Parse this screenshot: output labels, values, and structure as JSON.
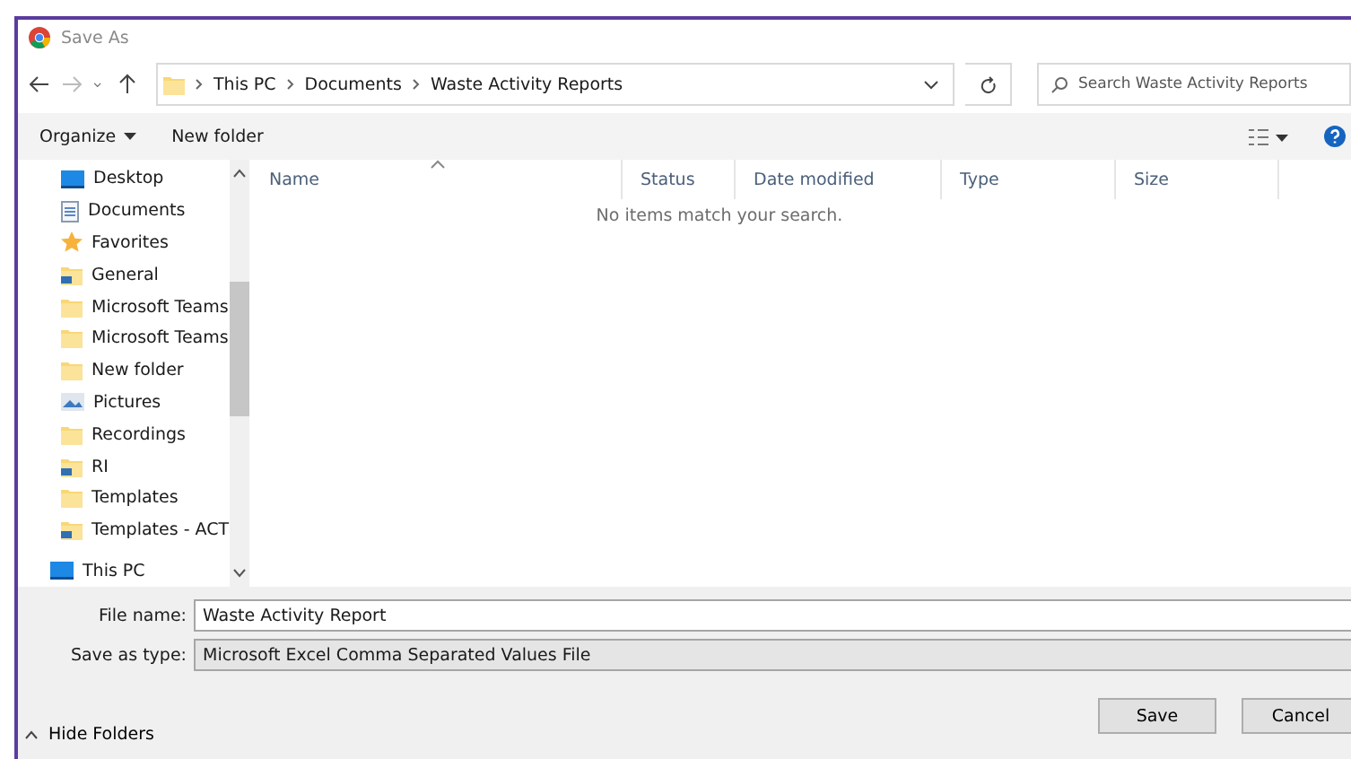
{
  "window": {
    "title": "Save As"
  },
  "address": {
    "crumbs": [
      "This PC",
      "Documents",
      "Waste Activity Reports"
    ]
  },
  "search": {
    "placeholder": "Search Waste Activity Reports"
  },
  "toolbar": {
    "organize": "Organize",
    "new_folder": "New folder"
  },
  "sidebar": {
    "items": [
      {
        "label": "Desktop",
        "kind": "desktop"
      },
      {
        "label": "Documents",
        "kind": "document"
      },
      {
        "label": "Favorites",
        "kind": "star"
      },
      {
        "label": "General",
        "kind": "linked"
      },
      {
        "label": "Microsoft Teams",
        "kind": "folder"
      },
      {
        "label": "Microsoft Teams",
        "kind": "folder"
      },
      {
        "label": "New folder",
        "kind": "folder"
      },
      {
        "label": "Pictures",
        "kind": "pictures"
      },
      {
        "label": "Recordings",
        "kind": "folder"
      },
      {
        "label": "RI",
        "kind": "linked"
      },
      {
        "label": "Templates",
        "kind": "folder"
      },
      {
        "label": "Templates - ACT",
        "kind": "linked"
      }
    ],
    "root": {
      "label": "This PC",
      "kind": "desktop"
    }
  },
  "table": {
    "columns": [
      {
        "label": "Name",
        "sorted": true
      },
      {
        "label": "Status",
        "sorted": false
      },
      {
        "label": "Date modified",
        "sorted": false
      },
      {
        "label": "Type",
        "sorted": false
      },
      {
        "label": "Size",
        "sorted": false
      }
    ],
    "empty_message": "No items match your search."
  },
  "form": {
    "file_name_label": "File name:",
    "file_name": "Waste Activity Report",
    "type_label": "Save as type:",
    "type": "Microsoft Excel Comma Separated Values File"
  },
  "footer": {
    "hide_folders": "Hide Folders",
    "buttons": [
      "Save",
      "Cancel"
    ]
  }
}
